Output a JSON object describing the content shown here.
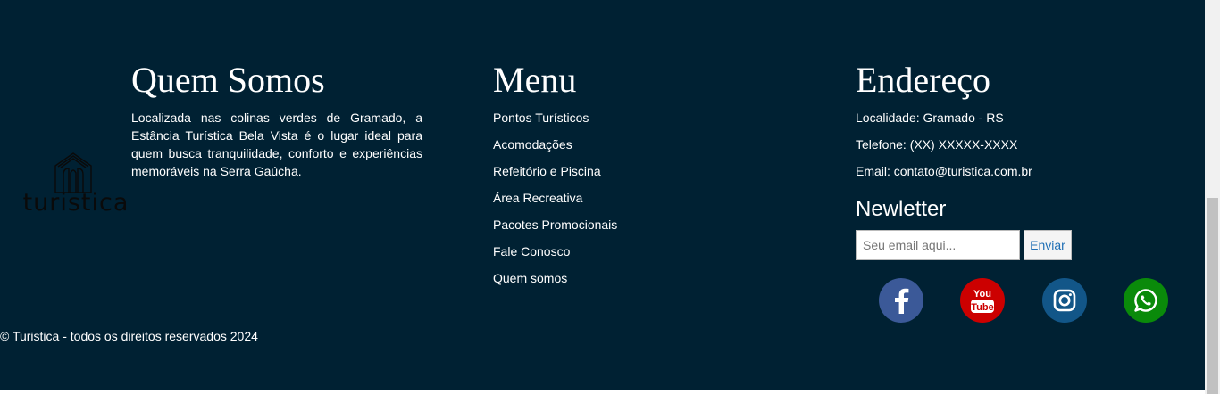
{
  "about": {
    "title": "Quem Somos",
    "text": "Localizada nas colinas verdes de Gramado, a Estância Turística Bela Vista é o lugar ideal para quem busca tranquilidade, conforto e experiências memoráveis na Serra Gaúcha."
  },
  "logo": {
    "text": "turistica",
    "icon": "house-arches-icon"
  },
  "menu": {
    "title": "Menu",
    "items": [
      "Pontos Turísticos",
      "Acomodações",
      "Refeitório e Piscina",
      "Área Recreativa",
      "Pacotes Promocionais",
      "Fale Conosco",
      "Quem somos"
    ]
  },
  "address": {
    "title": "Endereço",
    "locality": "Localidade: Gramado - RS",
    "phone": "Telefone: (XX) XXXXX-XXXX",
    "email": "Email: contato@turistica.com.br"
  },
  "newsletter": {
    "title": "Newletter",
    "placeholder": "Seu email aqui...",
    "button": "Enviar"
  },
  "social": [
    {
      "name": "facebook",
      "icon": "facebook-icon",
      "color": "#3b5998"
    },
    {
      "name": "youtube",
      "icon": "youtube-icon",
      "color": "#cc0000"
    },
    {
      "name": "instagram",
      "icon": "instagram-icon",
      "color": "#125688"
    },
    {
      "name": "whatsapp",
      "icon": "whatsapp-icon",
      "color": "#0a8a0a"
    }
  ],
  "copyright": "© Turistica - todos os direitos reservados 2024",
  "colors": {
    "background": "#002133",
    "text": "#ffffff",
    "button_text": "#1f6fb5"
  }
}
